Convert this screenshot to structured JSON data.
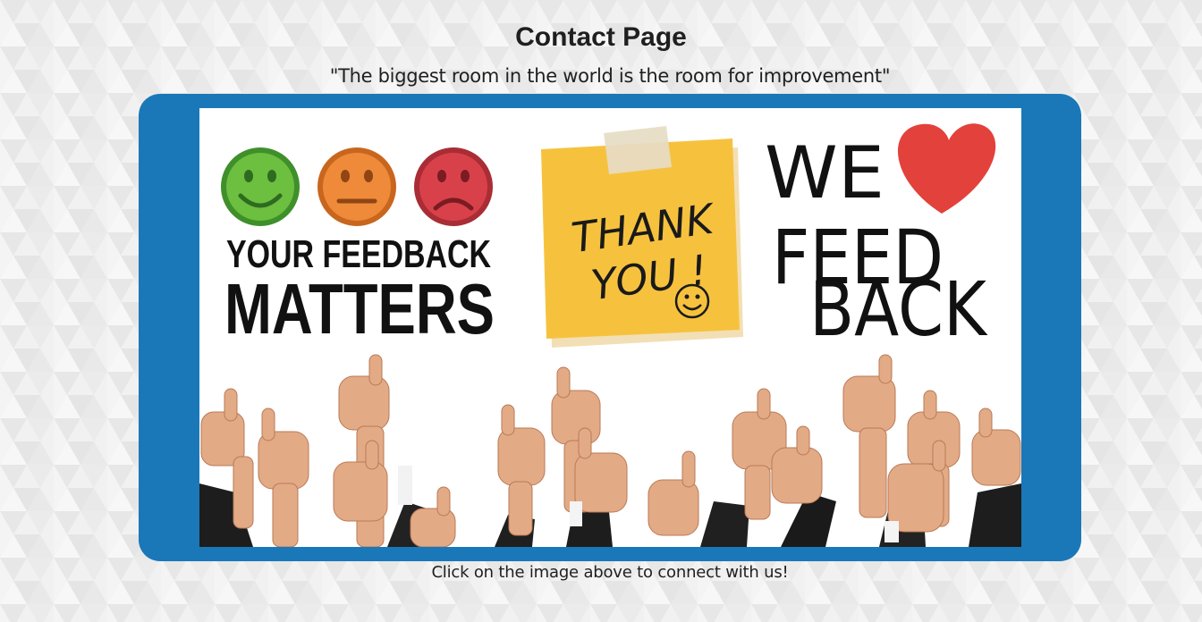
{
  "page": {
    "title": "Contact Page",
    "quote": "\"The biggest room in the world is the room for improvement\"",
    "caption": "Click on the image above to connect with us!"
  },
  "banner": {
    "feedback_line1": "YOUR FEEDBACK",
    "feedback_line2": "MATTERS",
    "note_line1": "THANK",
    "note_line2": "YOU !",
    "we_text": "WE",
    "feed_text": "FEED",
    "back_text": "BACK"
  },
  "colors": {
    "frame": "#1a78b8",
    "smiley_happy": "#6cbf3f",
    "smiley_neutral": "#ee8a3a",
    "smiley_sad": "#d9414a",
    "sticky_note": "#f6c23e",
    "heart": "#e3413b"
  }
}
